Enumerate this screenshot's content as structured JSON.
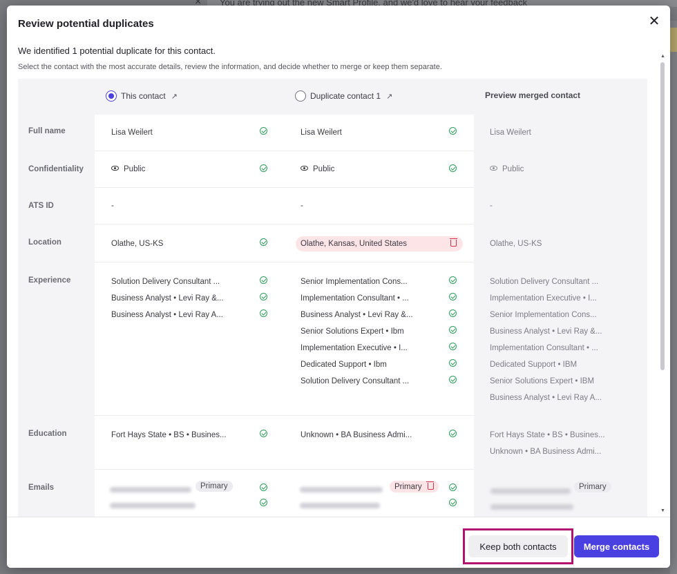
{
  "background": {
    "banner_text": "You are trying out the new Smart Profile, and we'd love to hear your feedback"
  },
  "modal": {
    "title": "Review potential duplicates",
    "close_icon": "close-icon",
    "intro": "We identified 1 potential duplicate for this contact.",
    "subtitle": "Select the contact with the most accurate details, review the information, and decide whether to merge or keep them separate."
  },
  "columns": {
    "this_contact": {
      "label": "This contact",
      "selected": true
    },
    "duplicate": {
      "label": "Duplicate contact 1",
      "selected": false
    },
    "preview": {
      "label": "Preview merged contact"
    }
  },
  "rows": {
    "full_name": {
      "label": "Full name",
      "this": "Lisa Weilert",
      "dup": "Lisa Weilert",
      "preview": "Lisa Weilert"
    },
    "confidentiality": {
      "label": "Confidentiality",
      "this": "Public",
      "dup": "Public",
      "preview": "Public"
    },
    "ats_id": {
      "label": "ATS ID",
      "this": "-",
      "dup": "-",
      "preview": "-"
    },
    "location": {
      "label": "Location",
      "this": "Olathe, US-KS",
      "dup": "Olathe, Kansas, United States",
      "preview": "Olathe, US-KS"
    },
    "experience": {
      "label": "Experience",
      "this": [
        "Solution Delivery Consultant ...",
        "Business Analyst • Levi Ray &...",
        "Business Analyst • Levi Ray A..."
      ],
      "dup": [
        "Senior Implementation Cons...",
        "Implementation Consultant • ...",
        "Business Analyst • Levi Ray &...",
        "Senior Solutions Expert • Ibm",
        "Implementation Executive • I...",
        "Dedicated Support • Ibm",
        "Solution Delivery Consultant ..."
      ],
      "preview": [
        "Solution Delivery Consultant ...",
        "Implementation Executive • I...",
        "Senior Implementation Cons...",
        "Business Analyst • Levi Ray &...",
        "Implementation Consultant • ...",
        "Dedicated Support • IBM",
        "Senior Solutions Expert • IBM",
        "Business Analyst • Levi Ray A..."
      ]
    },
    "education": {
      "label": "Education",
      "this": [
        "Fort Hays State • BS • Busines..."
      ],
      "dup": [
        "Unknown • BA Business Admi..."
      ],
      "preview": [
        "Fort Hays State • BS • Busines...",
        "Unknown • BA Business Admi..."
      ]
    },
    "emails": {
      "label": "Emails",
      "primary_label": "Primary"
    }
  },
  "footer": {
    "keep_label": "Keep both contacts",
    "merge_label": "Merge contacts"
  },
  "colors": {
    "accent": "#4a3fe0",
    "highlight_outline": "#b0126d",
    "check_green": "#2e9a5a",
    "conflict_red": "#d1344b"
  }
}
